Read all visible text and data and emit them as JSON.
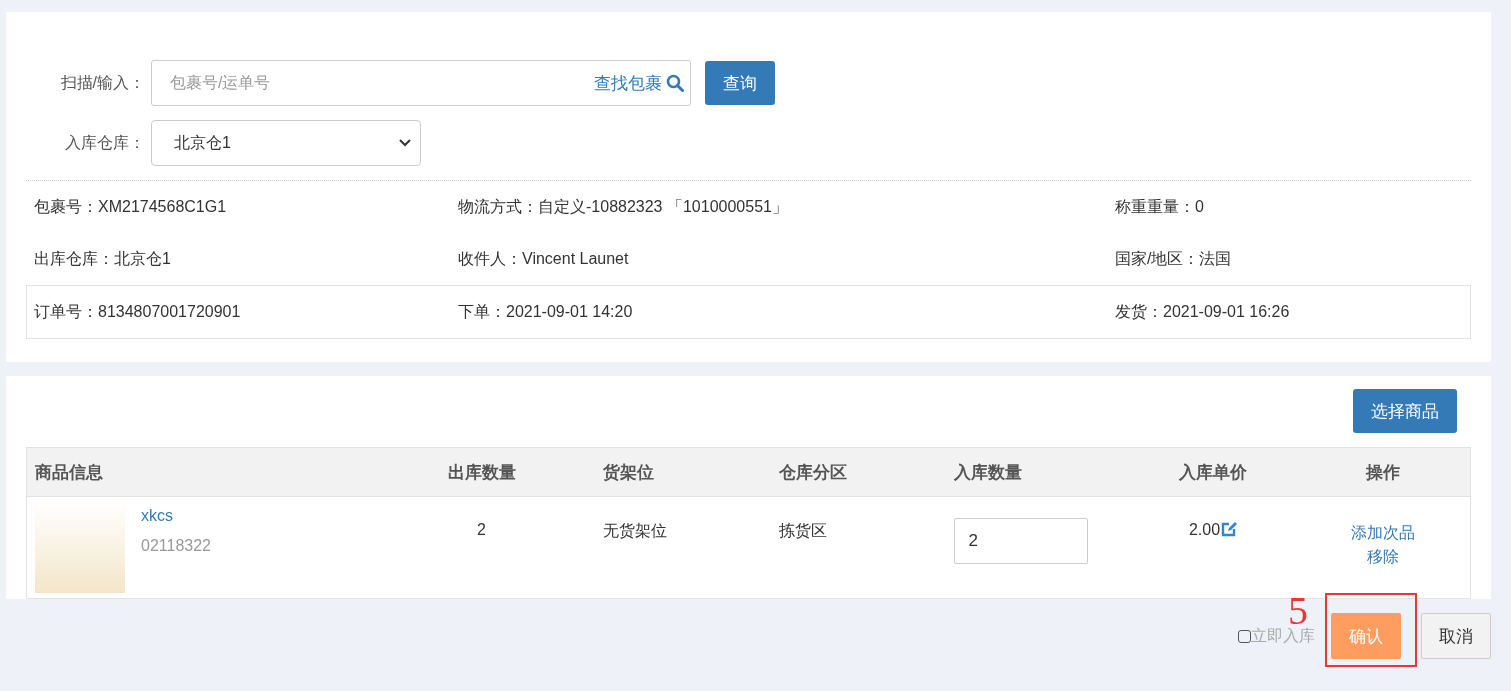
{
  "scan": {
    "label": "扫描/输入：",
    "placeholder": "包裹号/运单号",
    "find_link": "查找包裹",
    "button": "查询"
  },
  "warehouse": {
    "label": "入库仓库：",
    "value": "北京仓1"
  },
  "info_rows": [
    [
      {
        "label": "包裹号：",
        "value": "XM2174568C1G1"
      },
      {
        "label": "物流方式：",
        "value": "自定义-10882323 「1010000551」"
      },
      {
        "label": "称重重量：",
        "value": "0"
      }
    ],
    [
      {
        "label": "出库仓库：",
        "value": "北京仓1"
      },
      {
        "label": "收件人：",
        "value": "Vincent Launet"
      },
      {
        "label": "国家/地区：",
        "value": "法国"
      }
    ]
  ],
  "order_row": [
    {
      "label": "订单号：",
      "value": "8134807001720901"
    },
    {
      "label": "下单：",
      "value": "2021-09-01 14:20"
    },
    {
      "label": "发货：",
      "value": "2021-09-01 16:26"
    }
  ],
  "select_goods_button": "选择商品",
  "table": {
    "columns": [
      "商品信息",
      "出库数量",
      "货架位",
      "仓库分区",
      "入库数量",
      "入库单价",
      "操作"
    ],
    "rows": [
      {
        "name": "xkcs",
        "sku": "02118322",
        "out_qty": "2",
        "shelf": "无货架位",
        "zone": "拣货区",
        "in_qty": "2",
        "price": "2.00",
        "actions": [
          "添加次品",
          "移除"
        ]
      }
    ]
  },
  "footer": {
    "checkbox_label": "立即入库",
    "checked": false,
    "confirm": "确认",
    "cancel": "取消"
  },
  "annotation": {
    "label": "5"
  }
}
